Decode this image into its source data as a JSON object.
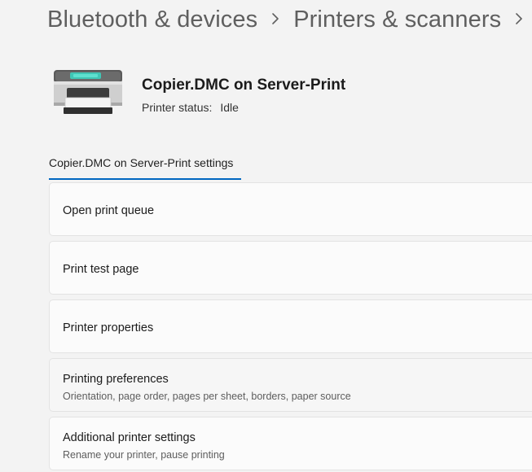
{
  "breadcrumb": {
    "items": [
      "Bluetooth & devices",
      "Printers & scanners"
    ],
    "separator_icon": "chevron-right-icon"
  },
  "printer": {
    "icon": "printer-icon",
    "name": "Copier.DMC on Server-Print",
    "status_label": "Printer status:",
    "status_value": "Idle"
  },
  "settings_tab": {
    "label": "Copier.DMC on Server-Print settings",
    "accent_color": "#0067c0"
  },
  "settings_items": [
    {
      "title": "Open print queue",
      "subtitle": ""
    },
    {
      "title": "Print test page",
      "subtitle": ""
    },
    {
      "title": "Printer properties",
      "subtitle": ""
    },
    {
      "title": "Printing preferences",
      "subtitle": "Orientation, page order, pages per sheet, borders, paper source"
    },
    {
      "title": "Additional printer settings",
      "subtitle": "Rename your printer, pause printing"
    }
  ]
}
